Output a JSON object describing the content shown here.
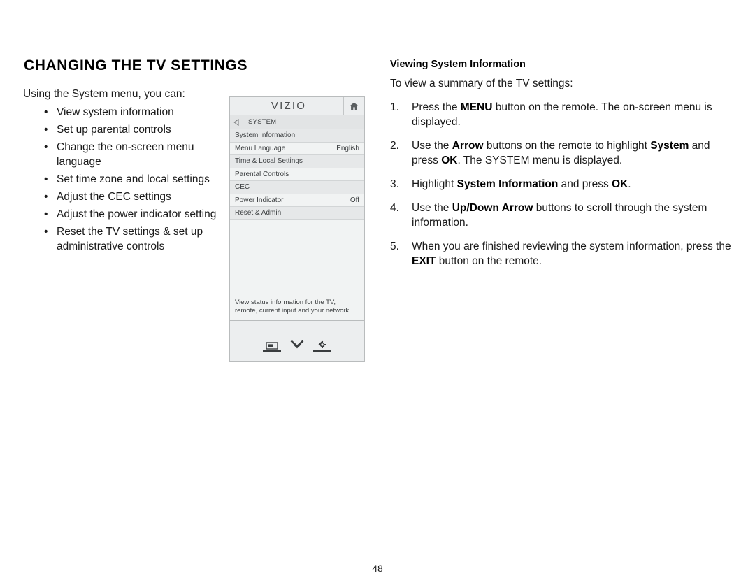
{
  "page": {
    "title": "CHANGING THE TV SETTINGS",
    "number": "48"
  },
  "left_column": {
    "intro": "Using the System menu, you can:",
    "bullet_glyph": "•",
    "bullets": [
      "View system information",
      "Set up parental controls",
      "Change the on-screen menu language",
      "Set time zone and local settings",
      "Adjust the CEC settings",
      "Adjust the power indicator setting",
      "Reset the TV settings & set up administrative controls"
    ]
  },
  "tv_menu": {
    "brand": "VIZIO",
    "home_icon": "home-icon",
    "back_icon": "back-arrow-icon",
    "breadcrumb": "SYSTEM",
    "rows": [
      {
        "label": "System Information",
        "value": ""
      },
      {
        "label": "Menu Language",
        "value": "English"
      },
      {
        "label": "Time & Local Settings",
        "value": ""
      },
      {
        "label": "Parental Controls",
        "value": ""
      },
      {
        "label": "CEC",
        "value": ""
      },
      {
        "label": "Power Indicator",
        "value": "Off"
      },
      {
        "label": "Reset & Admin",
        "value": ""
      }
    ],
    "description": "View status information for the TV, remote, current input and your network.",
    "footer_icons": [
      "display-icon",
      "chevron-double-down-icon",
      "gear-icon"
    ],
    "colors": {
      "panel_bg": "#eceeef",
      "row_light": "#f1f3f3",
      "row_dark": "#e6e8e9",
      "border": "#b9bcbd",
      "text": "#3a3d3f"
    }
  },
  "right_column": {
    "heading": "Viewing System Information",
    "intro": "To view a summary of the TV settings:",
    "steps": [
      {
        "num": "1.",
        "parts": [
          {
            "t": "Press the ",
            "b": false
          },
          {
            "t": "MENU",
            "b": true
          },
          {
            "t": " button on the remote. The on-screen menu is displayed.",
            "b": false
          }
        ]
      },
      {
        "num": "2.",
        "parts": [
          {
            "t": "Use the ",
            "b": false
          },
          {
            "t": "Arrow",
            "b": true
          },
          {
            "t": " buttons on the remote to highlight ",
            "b": false
          },
          {
            "t": "System",
            "b": true
          },
          {
            "t": " and press ",
            "b": false
          },
          {
            "t": "OK",
            "b": true
          },
          {
            "t": ". The SYSTEM menu is displayed.",
            "b": false
          }
        ]
      },
      {
        "num": "3.",
        "parts": [
          {
            "t": "Highlight ",
            "b": false
          },
          {
            "t": "System Information",
            "b": true
          },
          {
            "t": " and press ",
            "b": false
          },
          {
            "t": "OK",
            "b": true
          },
          {
            "t": ".",
            "b": false
          }
        ]
      },
      {
        "num": "4.",
        "parts": [
          {
            "t": "Use the ",
            "b": false
          },
          {
            "t": "Up/Down Arrow",
            "b": true
          },
          {
            "t": " buttons to scroll through the system information.",
            "b": false
          }
        ]
      },
      {
        "num": "5.",
        "parts": [
          {
            "t": "When you are finished reviewing the system information, press the ",
            "b": false
          },
          {
            "t": "EXIT",
            "b": true
          },
          {
            "t": " button on the remote.",
            "b": false
          }
        ]
      }
    ]
  }
}
